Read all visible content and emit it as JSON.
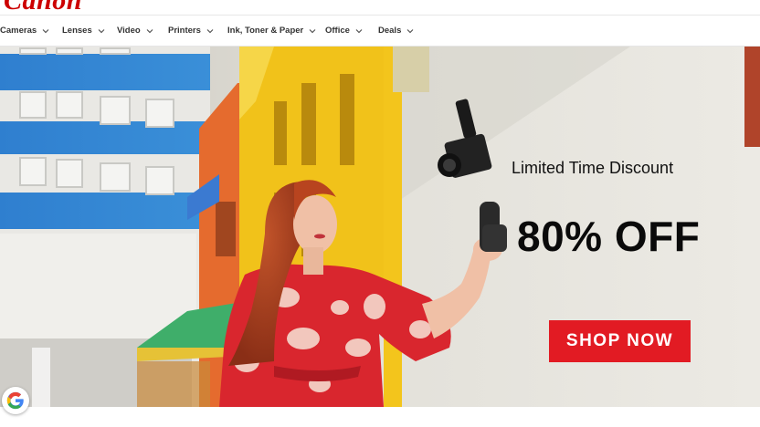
{
  "brand": {
    "logo_text": "Canon",
    "logo_color": "#cc0000"
  },
  "nav": {
    "items": [
      {
        "label": "Cameras"
      },
      {
        "label": "Lenses"
      },
      {
        "label": "Video"
      },
      {
        "label": "Printers"
      },
      {
        "label": "Ink, Toner & Paper"
      },
      {
        "label": "Office"
      },
      {
        "label": "Deals"
      }
    ]
  },
  "hero": {
    "promo_line": "Limited Time Discount",
    "discount": "80% OFF",
    "cta_label": "SHOP NOW",
    "cta_color": "#e21b23",
    "image_subject": "woman in red dress holding a vlogging camera on a grip in front of colorful buildings"
  },
  "badge": {
    "icon": "google-icon"
  }
}
